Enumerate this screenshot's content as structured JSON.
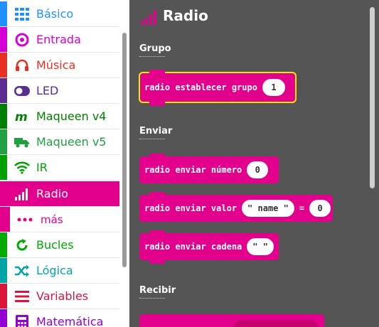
{
  "toolbox": {
    "categories": [
      {
        "label": "Básico",
        "color": "#1e90ff",
        "icon": "grid-icon"
      },
      {
        "label": "Entrada",
        "color": "#d400d4",
        "icon": "target-icon"
      },
      {
        "label": "Música",
        "color": "#e63022",
        "icon": "headphones-icon"
      },
      {
        "label": "LED",
        "color": "#5c2d91",
        "icon": "toggle-icon"
      },
      {
        "label": "Maqueen v4",
        "color": "#008000",
        "icon": "maqueen-m-icon"
      },
      {
        "label": "Maqueen v5",
        "color": "#20a040",
        "icon": "truck-icon"
      },
      {
        "label": "IR",
        "color": "#00a000",
        "icon": "wifi-icon"
      },
      {
        "label": "Radio",
        "color": "#e3008c",
        "icon": "signal-bars-icon",
        "selected": true
      },
      {
        "label": "más",
        "color": "#e3008c",
        "icon": "dots-icon",
        "sub": true
      },
      {
        "label": "Bucles",
        "color": "#00aa00",
        "icon": "loop-icon"
      },
      {
        "label": "Lógica",
        "color": "#00a4a6",
        "icon": "shuffle-icon"
      },
      {
        "label": "Variables",
        "color": "#dc143c",
        "icon": "list-icon"
      },
      {
        "label": "Matemática",
        "color": "#9400d3",
        "icon": "calculator-icon"
      }
    ]
  },
  "flyout": {
    "title": "Radio",
    "sections": {
      "grupo": "Grupo",
      "enviar": "Enviar",
      "recibir": "Recibir"
    },
    "blocks": {
      "set_group": {
        "text": "radio establecer grupo",
        "value": "1"
      },
      "send_number": {
        "text": "radio enviar número",
        "value": "0"
      },
      "send_value": {
        "text": "radio enviar valor",
        "name": "\" name \"",
        "eq": "=",
        "value": "0"
      },
      "send_string": {
        "text": "radio enviar cadena",
        "value": "\" \""
      }
    }
  },
  "colors": {
    "radio": "#e3008c",
    "flyout_bg": "#555555",
    "highlight": "#ffea00"
  }
}
